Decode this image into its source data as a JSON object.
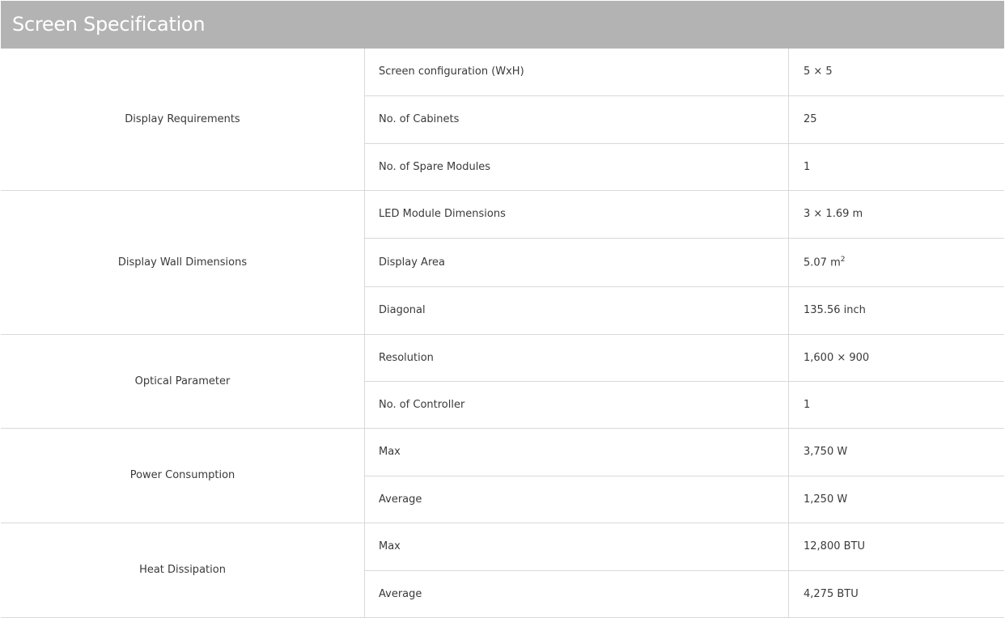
{
  "title": "Screen Specification",
  "groups": [
    {
      "name": "Display Requirements",
      "rows": [
        {
          "label": "Screen configuration (WxH)",
          "value": "5 × 5"
        },
        {
          "label": "No. of Cabinets",
          "value": "25"
        },
        {
          "label": "No. of Spare Modules",
          "value": "1"
        }
      ]
    },
    {
      "name": "Display Wall Dimensions",
      "rows": [
        {
          "label": "LED Module Dimensions",
          "value": "3 × 1.69 m"
        },
        {
          "label": "Display Area",
          "value": "5.07 m",
          "sup": "2"
        },
        {
          "label": "Diagonal",
          "value": "135.56 inch"
        }
      ]
    },
    {
      "name": "Optical Parameter",
      "rows": [
        {
          "label": "Resolution",
          "value": "1,600 × 900"
        },
        {
          "label": "No. of Controller",
          "value": "1"
        }
      ]
    },
    {
      "name": "Power Consumption",
      "rows": [
        {
          "label": "Max",
          "value": "3,750 W"
        },
        {
          "label": "Average",
          "value": "1,250 W"
        }
      ]
    },
    {
      "name": "Heat Dissipation",
      "rows": [
        {
          "label": "Max",
          "value": "12,800 BTU"
        },
        {
          "label": "Average",
          "value": "4,275 BTU"
        }
      ]
    }
  ]
}
